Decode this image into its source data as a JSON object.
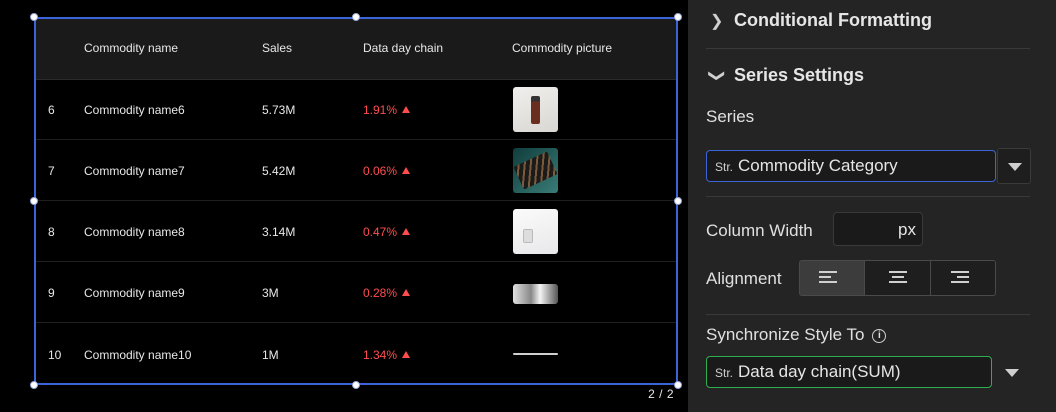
{
  "table": {
    "columns": [
      "Commodity name",
      "Sales",
      "Data day chain",
      "Commodity picture"
    ],
    "rows": [
      {
        "index": "6",
        "name": "Commodity name6",
        "sales": "5.73M",
        "chain": "1.91%"
      },
      {
        "index": "7",
        "name": "Commodity name7",
        "sales": "5.42M",
        "chain": "0.06%"
      },
      {
        "index": "8",
        "name": "Commodity name8",
        "sales": "3.14M",
        "chain": "0.47%"
      },
      {
        "index": "9",
        "name": "Commodity name9",
        "sales": "3M",
        "chain": "0.28%"
      },
      {
        "index": "10",
        "name": "Commodity name10",
        "sales": "1M",
        "chain": "1.34%"
      }
    ],
    "pager": "2 / 2"
  },
  "panel": {
    "conditional_formatting": "Conditional Formatting",
    "series_settings": "Series Settings",
    "series_label": "Series",
    "series_select": {
      "tag": "Str.",
      "value": "Commodity Category"
    },
    "column_width_label": "Column Width",
    "column_width_unit": "px",
    "alignment_label": "Alignment",
    "sync_label": "Synchronize Style To",
    "sync_select": {
      "tag": "Str.",
      "value": "Data day chain(SUM)"
    }
  },
  "colors": {
    "accent_blue": "#3a64d8",
    "positive_red": "#ff4d4f",
    "sync_green": "#2fae4f"
  },
  "icons": [
    "chevron-right-icon",
    "chevron-down-icon",
    "caret-down-icon",
    "align-left-icon",
    "align-center-icon",
    "align-right-icon",
    "info-icon",
    "arrow-up-icon"
  ]
}
